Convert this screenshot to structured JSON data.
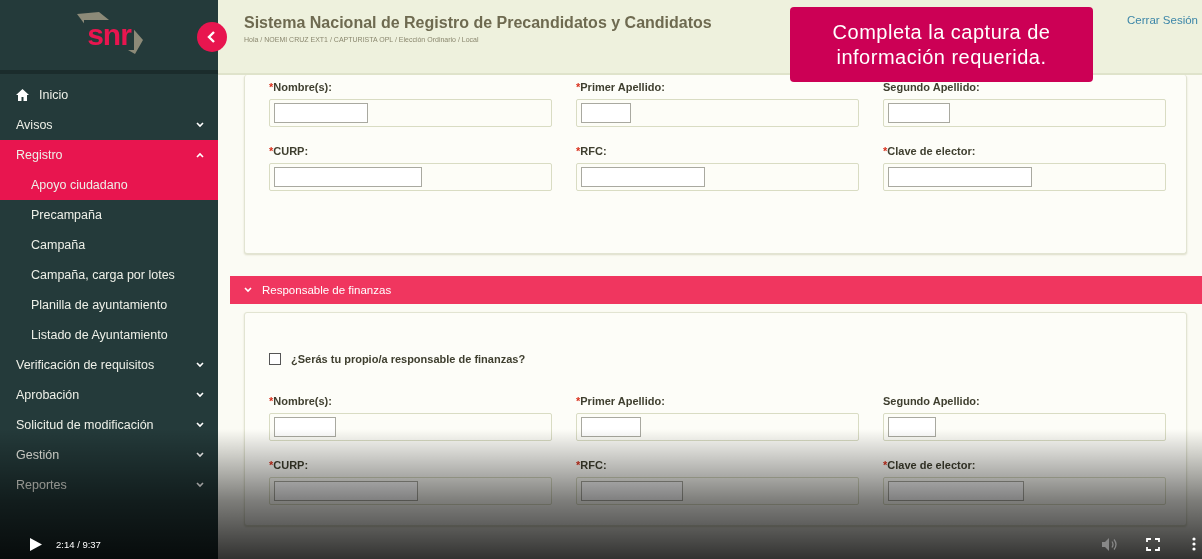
{
  "sidebar": {
    "logo_text": "snr",
    "collapse_button": {
      "expanded": true
    },
    "items": [
      {
        "kind": "home",
        "label": "Inicio",
        "selected": false
      },
      {
        "kind": "group",
        "label": "Avisos",
        "selected": false,
        "expanded": false
      },
      {
        "kind": "group",
        "label": "Registro",
        "selected": true,
        "expanded": true,
        "children": [
          {
            "label": "Apoyo ciudadano",
            "selected": true
          },
          {
            "label": "Precampaña",
            "selected": false
          },
          {
            "label": "Campaña",
            "selected": false
          },
          {
            "label": "Campaña, carga por lotes",
            "selected": false
          },
          {
            "label": "Planilla de ayuntamiento",
            "selected": false
          },
          {
            "label": "Listado de Ayuntamiento",
            "selected": false
          }
        ]
      },
      {
        "kind": "group",
        "label": "Verificación de requisitos",
        "selected": false,
        "expanded": false
      },
      {
        "kind": "group",
        "label": "Aprobación",
        "selected": false,
        "expanded": false
      },
      {
        "kind": "group",
        "label": "Solicitud de modificación",
        "selected": false,
        "expanded": false
      },
      {
        "kind": "group",
        "label": "Gestión",
        "selected": false,
        "expanded": false
      },
      {
        "kind": "group",
        "label": "Reportes",
        "selected": false,
        "expanded": false
      }
    ]
  },
  "header": {
    "title": "Sistema Nacional de Registro de Precandidatos y Candidatos",
    "breadcrumb": "Hola / NOEMI CRUZ EXT1 / CAPTURISTA OPL / Elección Ordinario / Local",
    "logout": "Cerrar Sesión"
  },
  "toast": "Completa la captura de información requerida.",
  "sections": [
    {
      "fields": [
        {
          "label": "Nombre(s):",
          "mark": "*"
        },
        {
          "label": "Primer Apellido:",
          "mark": "*"
        },
        {
          "label": "Segundo Apellido:"
        },
        {
          "label": "CURP:",
          "mark": "*"
        },
        {
          "label": "RFC:",
          "mark": "*"
        },
        {
          "label": "Clave de elector:",
          "mark": "*"
        }
      ]
    },
    {
      "title": "Responsable de finanzas",
      "expanded": true,
      "checkbox": {
        "label": "¿Serás tu propio/a responsable de finanzas?",
        "checked": false
      },
      "fields": [
        {
          "label": "Nombre(s):",
          "mark": "*"
        },
        {
          "label": "Primer Apellido:",
          "mark": "*"
        },
        {
          "label": "Segundo Apellido:"
        },
        {
          "label": "CURP:",
          "mark": "*"
        },
        {
          "label": "RFC:",
          "mark": "*"
        },
        {
          "label": "Clave de elector:",
          "mark": "*"
        }
      ]
    }
  ],
  "player": {
    "time": "2:14 / 9:37",
    "playing": false
  }
}
